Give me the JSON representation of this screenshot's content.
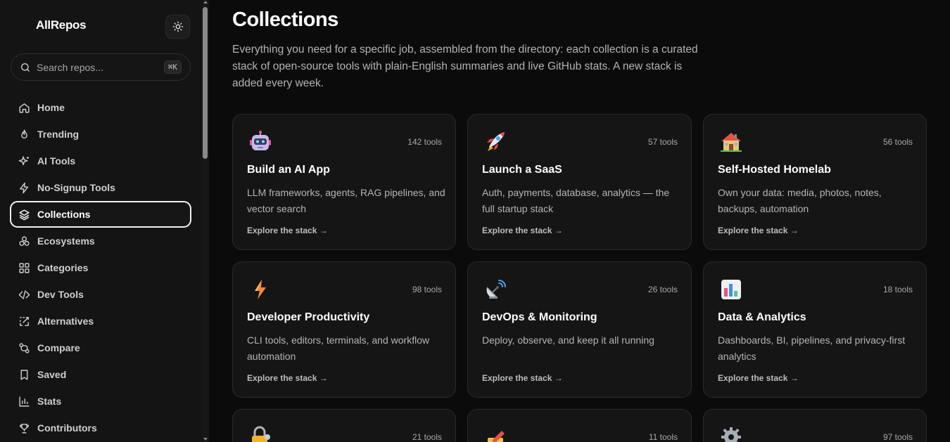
{
  "sidebar": {
    "brand": "AllRepos",
    "search": {
      "placeholder": "Search repos...",
      "shortcut": "⌘K"
    },
    "items": [
      {
        "label": "Home",
        "icon": "home-icon"
      },
      {
        "label": "Trending",
        "icon": "flame-icon"
      },
      {
        "label": "AI Tools",
        "icon": "sparkles-icon"
      },
      {
        "label": "No-Signup Tools",
        "icon": "zap-icon"
      },
      {
        "label": "Collections",
        "icon": "layers-icon",
        "active": true
      },
      {
        "label": "Ecosystems",
        "icon": "ecosystem-icon"
      },
      {
        "label": "Categories",
        "icon": "grid-icon"
      },
      {
        "label": "Dev Tools",
        "icon": "code-icon"
      },
      {
        "label": "Alternatives",
        "icon": "alternatives-icon"
      },
      {
        "label": "Compare",
        "icon": "compare-icon"
      },
      {
        "label": "Saved",
        "icon": "bookmark-icon"
      },
      {
        "label": "Stats",
        "icon": "bar-chart-icon"
      },
      {
        "label": "Contributors",
        "icon": "trophy-icon"
      }
    ]
  },
  "main": {
    "title": "Collections",
    "description": "Everything you need for a specific job, assembled from the directory: each collection is a curated stack of open-source tools with plain-English summaries and live GitHub stats. A new stack is added every week.",
    "cards": [
      {
        "icon": "robot-icon",
        "count": "142 tools",
        "title": "Build an AI App",
        "desc": "LLM frameworks, agents, RAG pipelines, and vector search",
        "link": "Explore the stack →"
      },
      {
        "icon": "rocket-icon",
        "count": "57 tools",
        "title": "Launch a SaaS",
        "desc": "Auth, payments, database, analytics — the full startup stack",
        "link": "Explore the stack →"
      },
      {
        "icon": "house-icon",
        "count": "56 tools",
        "title": "Self-Hosted Homelab",
        "desc": "Own your data: media, photos, notes, backups, automation",
        "link": "Explore the stack →"
      },
      {
        "icon": "lightning-icon",
        "count": "98 tools",
        "title": "Developer Productivity",
        "desc": "CLI tools, editors, terminals, and workflow automation",
        "link": "Explore the stack →"
      },
      {
        "icon": "satellite-icon",
        "count": "26 tools",
        "title": "DevOps & Monitoring",
        "desc": "Deploy, observe, and keep it all running",
        "link": "Explore the stack →"
      },
      {
        "icon": "chart-icon",
        "count": "18 tools",
        "title": "Data & Analytics",
        "desc": "Dashboards, BI, pipelines, and privacy-first analytics",
        "link": "Explore the stack →"
      },
      {
        "icon": "lock-icon",
        "count": "21 tools"
      },
      {
        "icon": "pencil-icon",
        "count": "11 tools"
      },
      {
        "icon": "gear-icon",
        "count": "97 tools"
      }
    ]
  }
}
